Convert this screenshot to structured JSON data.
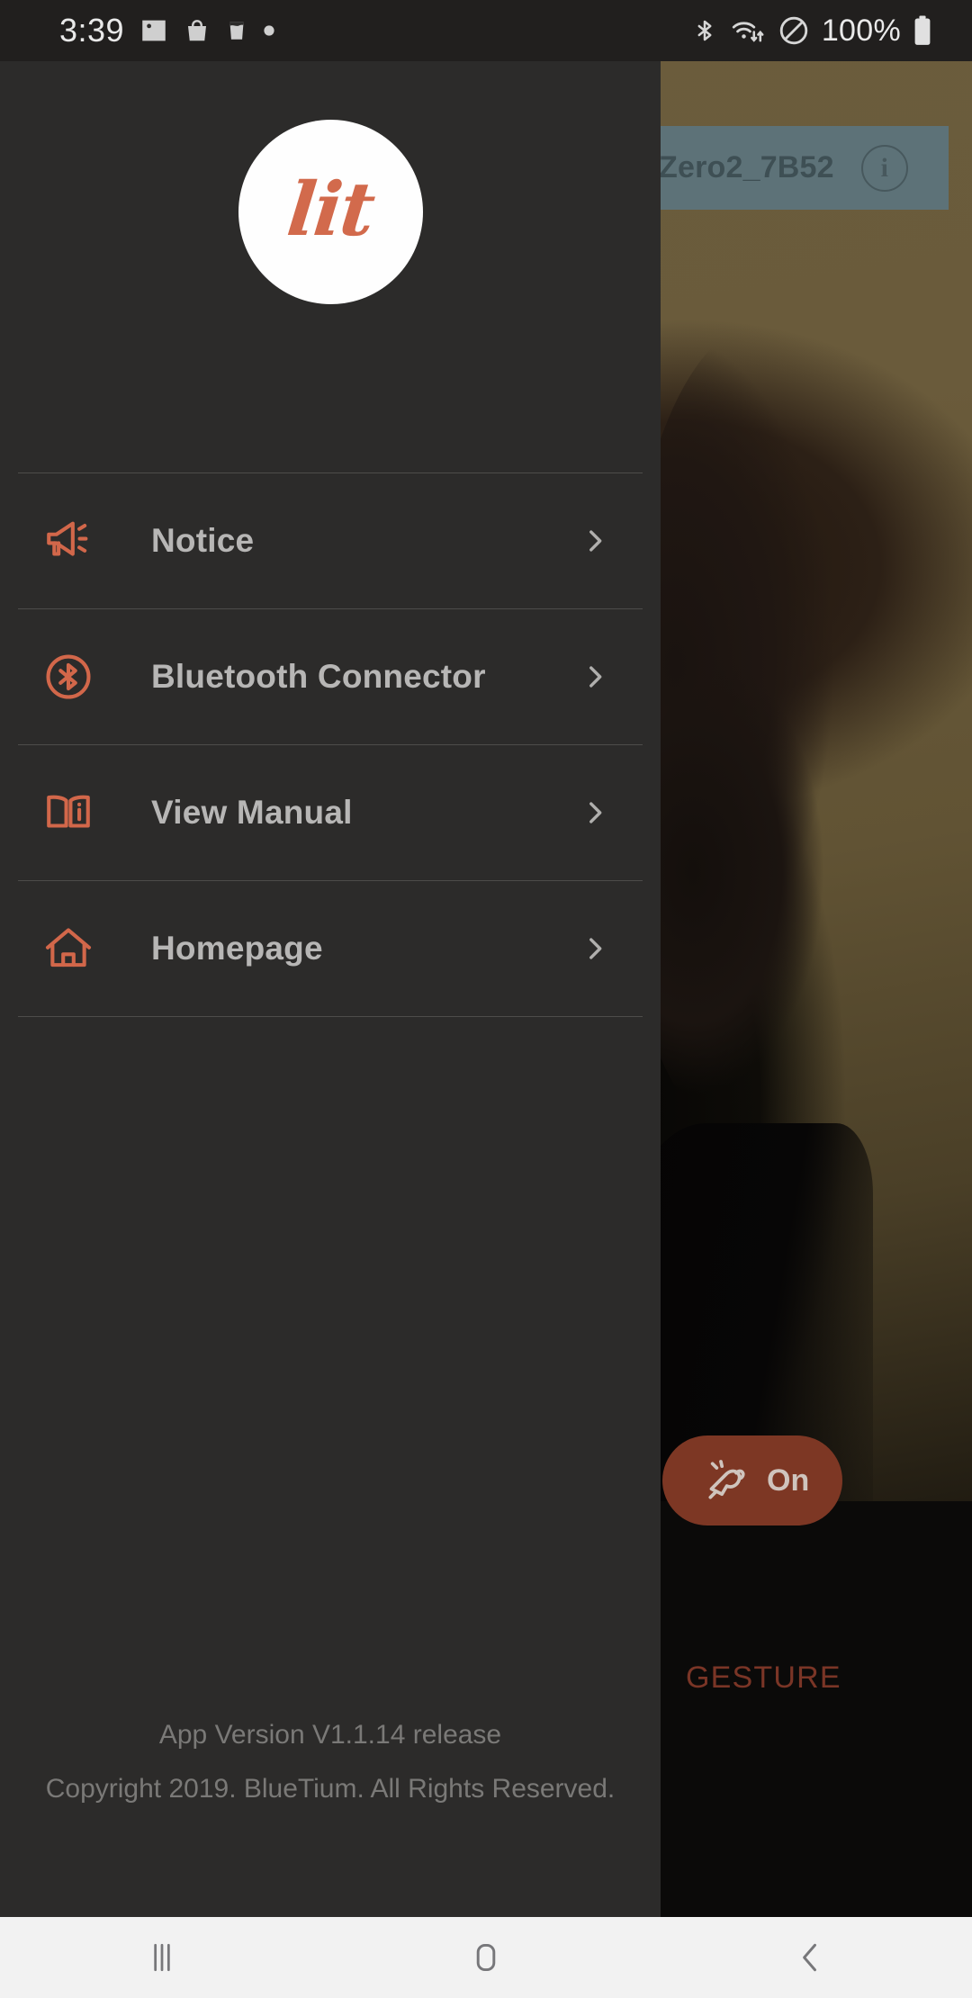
{
  "status_bar": {
    "time": "3:39",
    "battery_percent": "100%",
    "left_icons": [
      "image-icon",
      "shopping-bag-icon",
      "water-glass-icon",
      "dot-icon"
    ],
    "right_icons": [
      "bluetooth-icon",
      "wifi-icon",
      "do-not-disturb-icon",
      "battery-icon"
    ]
  },
  "drawer": {
    "logo_text": "lit",
    "menu_items": [
      {
        "label": "Notice",
        "icon": "megaphone-icon"
      },
      {
        "label": "Bluetooth Connector",
        "icon": "bluetooth-circle-icon"
      },
      {
        "label": "View Manual",
        "icon": "open-book-info-icon"
      },
      {
        "label": "Homepage",
        "icon": "home-icon"
      }
    ],
    "footer": {
      "version": "App Version V1.1.14 release",
      "copyright": "Copyright 2019. BlueTium. All Rights Reserved."
    }
  },
  "background_app": {
    "device_name": "Zero2_7B52",
    "device_info_icon": "info-circle-icon",
    "power_button_label": "On",
    "power_button_icon": "gesture-hand-icon",
    "section_label": "GESTURE"
  },
  "nav_bar": {
    "buttons": [
      {
        "name": "recents",
        "icon": "recents-icon"
      },
      {
        "name": "home",
        "icon": "home-square-icon"
      },
      {
        "name": "back",
        "icon": "back-chevron-icon"
      }
    ]
  },
  "colors": {
    "accent_orange": "#d26a4c",
    "drawer_bg": "#2c2b2a",
    "device_bar": "#5d7278",
    "pill_bg": "#7d3724",
    "gesture_text": "#7a3526"
  }
}
